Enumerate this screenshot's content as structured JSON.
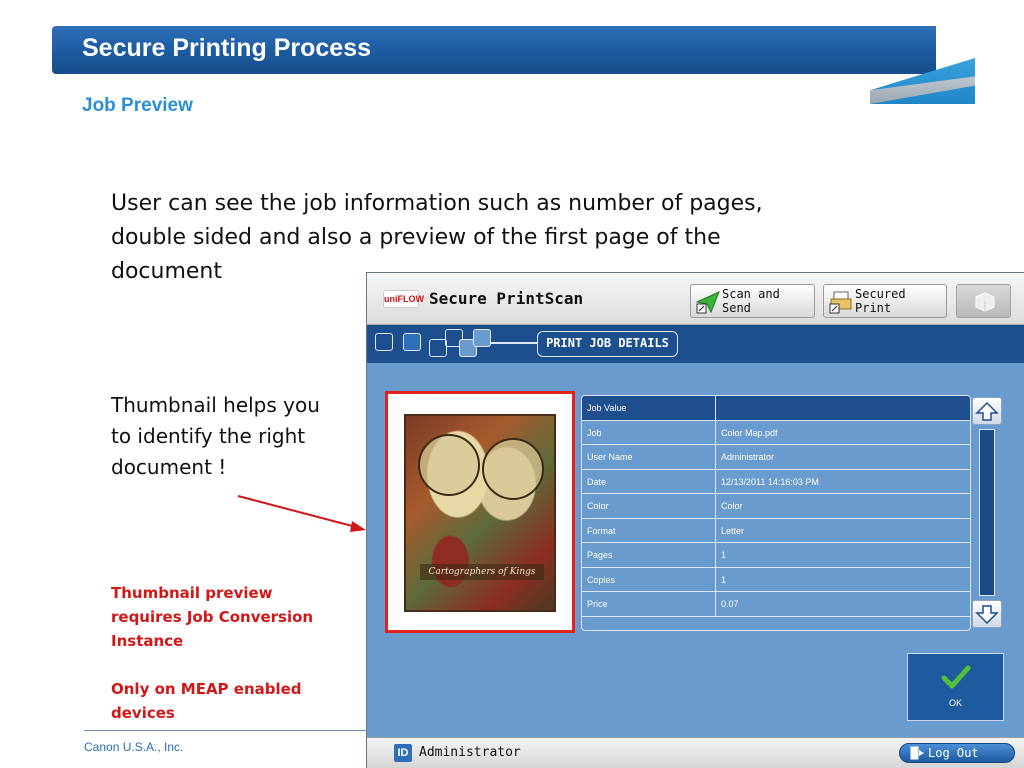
{
  "slide": {
    "title": "Secure Printing Process",
    "subtitle": "Job Preview",
    "body_text": "User can see the job information such as number of pages, double sided and also a preview of the first page of the document",
    "thumbnail_text": "Thumbnail helps you to identify the right document !",
    "note_1": "Thumbnail preview requires Job Conversion Instance",
    "note_2": "Only on MEAP enabled devices",
    "footer": "Canon U.S.A., Inc."
  },
  "device": {
    "logo_text": "uniFLOW",
    "app_title": "Secure PrintScan",
    "scan_send_label": "Scan and\nSend",
    "secured_print_label": "Secured\nPrint",
    "breadcrumb_label": "PRINT JOB DETAILS",
    "thumbnail_caption": "Cartographers of Kings",
    "details": {
      "header": {
        "key": "Job Value",
        "value": ""
      },
      "rows": [
        {
          "key": "Job",
          "value": "Color Map.pdf"
        },
        {
          "key": "User Name",
          "value": "Administrator"
        },
        {
          "key": "Date",
          "value": "12/13/2011 14:16:03 PM"
        },
        {
          "key": "Color",
          "value": "Color"
        },
        {
          "key": "Format",
          "value": "Letter"
        },
        {
          "key": "Pages",
          "value": "1"
        },
        {
          "key": "Copies",
          "value": "1"
        },
        {
          "key": "Price",
          "value": "0.07"
        }
      ]
    },
    "ok_label": "OK",
    "user": "Administrator",
    "id_badge": "ID",
    "logout_label": "Log Out"
  },
  "colors": {
    "title_bar": "#1c5a9e",
    "subtitle": "#2a8fd6",
    "note_red": "#d11818",
    "device_bg": "#6a9bcf",
    "nav_bar": "#1d4f8e",
    "thumb_border": "#e0231f"
  }
}
